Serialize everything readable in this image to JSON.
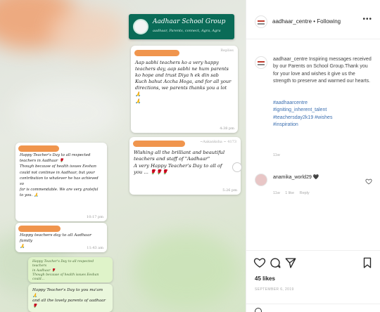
{
  "post": {
    "username": "aadhaar_centre",
    "follow_separator": " • ",
    "follow_label": "Following",
    "more_label": "•••"
  },
  "group": {
    "title": "Aadhaar School Group",
    "subtitle": "aadhaar, Parents, connect, Agra, Agra"
  },
  "messages": [
    {
      "meta": "Replies",
      "text": "Aap sabhi teachers ko a very happy\nteachers day, aap sabhi ne hum parents\nko hope and trust Diya h ek din sab\nKuch bahut Accha Hoga, and for all your\ndirections, we parents thanks you a lot 🙏\n🙏",
      "time": "4:38 pm"
    },
    {
      "meta": "~Aakanksha ~ 4173",
      "text": "Wishing all the brilliant and beautiful\nteachers and staff of \"Aadhaar\"\nA very Happy Teacher's Day to all of\nyou ... 🌹🌹🌹",
      "time": "5:26 pm"
    },
    {
      "meta": "",
      "text": "Happy Teacher's Day to all respected\nteachers in Aadhaar 🌹\nThough because of health issues Eeshan\ncould not continue in Aadhaar, but your\ncontribution to whatever he has achieved so\nfar is commendable. We are very grateful\nto you. 🙏",
      "time": "10:17 pm"
    },
    {
      "meta": "",
      "text": "Happy teachers day to all Aadhaar family\n🙏",
      "time": "11:43 am"
    },
    {
      "meta": "",
      "text": "Happy Teacher's Day to all respected teachers\nin Aadhaar 🌹\nThough because of health issues Eeshan could...",
      "time": ""
    },
    {
      "meta": "",
      "text": "Happy Teacher's Day to you ma'am 🙏\nand all the lovely parents of aadhaar 🌹",
      "time": ""
    }
  ],
  "caption": {
    "username": "aadhaar_centre",
    "text": "Inspiring messages received by our Parents on School Group.Thank you for your love and wishes it give us the strength to preserve and warmed our hearts.",
    "hashtags": "#aadhaarcentre\n#igniting_inherent_talent\n#teachersday2k19 #wishes\n#inspiration",
    "time": "11w"
  },
  "comment": {
    "username": "anamika_world29",
    "badge": "🖤",
    "time": "11w",
    "likes": "1 like",
    "reply": "Reply"
  },
  "stats": {
    "likes": "45 likes",
    "date": "SEPTEMBER 6, 2019"
  },
  "icons": {
    "more": "more-icon",
    "heart": "heart-icon",
    "comment": "comment-icon",
    "share": "share-icon",
    "bookmark": "bookmark-icon",
    "emoji": "emoji-icon"
  },
  "colors": {
    "whatsapp_header": "#0a6b57",
    "redaction": "#ee8a3a",
    "hashtag": "#3b6fb0"
  }
}
